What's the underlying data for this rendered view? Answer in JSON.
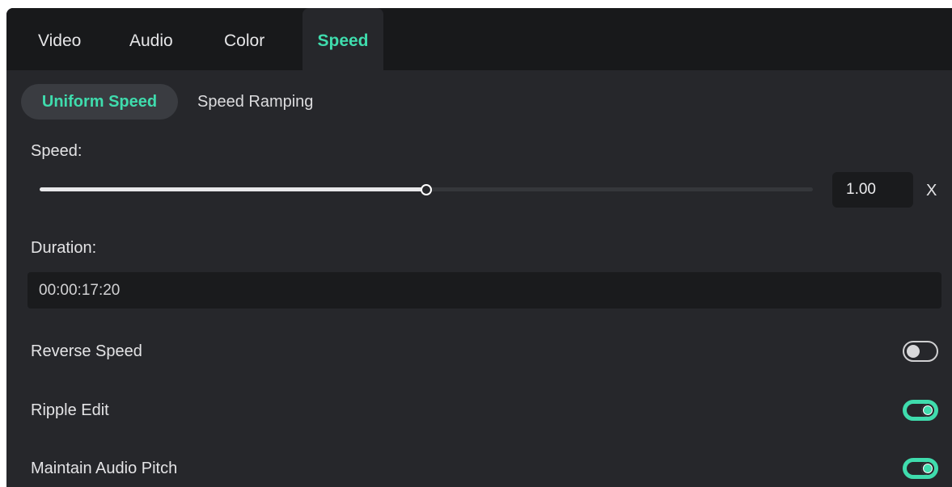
{
  "tabs": {
    "video": "Video",
    "audio": "Audio",
    "color": "Color",
    "speed": "Speed",
    "active": "Speed"
  },
  "mode_tabs": {
    "uniform": "Uniform Speed",
    "ramping": "Speed Ramping",
    "active": "Uniform Speed"
  },
  "speed": {
    "label": "Speed:",
    "value": "1.00",
    "unit": "X",
    "slider_position_fraction": 0.5
  },
  "duration": {
    "label": "Duration:",
    "value": "00:00:17:20"
  },
  "options": {
    "reverse_speed": {
      "label": "Reverse Speed",
      "enabled": false
    },
    "ripple_edit": {
      "label": "Ripple Edit",
      "enabled": true
    },
    "maintain_audio_pitch": {
      "label": "Maintain Audio Pitch",
      "enabled": true
    }
  },
  "colors": {
    "accent": "#3fdcad",
    "panel": "#26272b",
    "tabbar": "#18191b"
  }
}
